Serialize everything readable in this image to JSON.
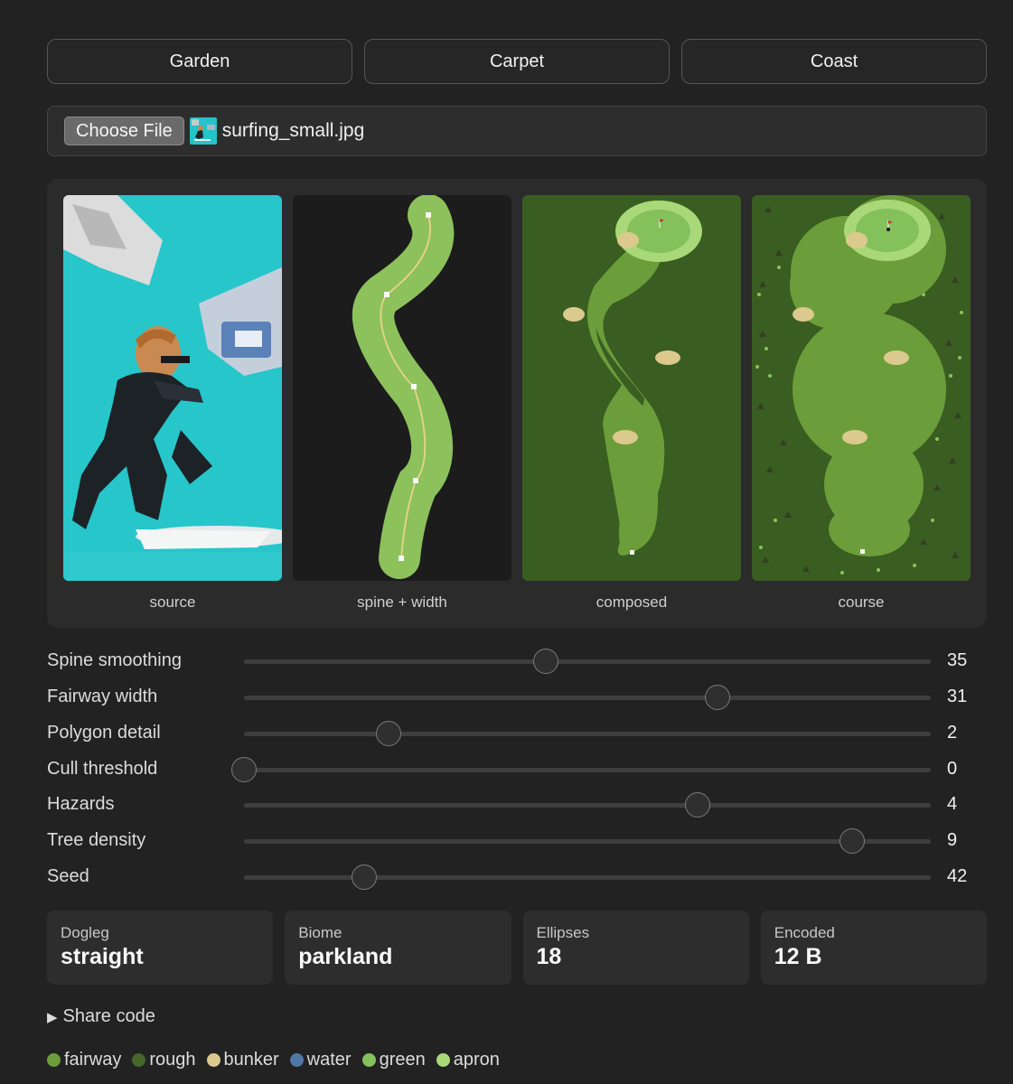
{
  "presets": [
    {
      "label": "Garden"
    },
    {
      "label": "Carpet"
    },
    {
      "label": "Coast"
    }
  ],
  "file": {
    "button_label": "Choose File",
    "filename": "surfing_small.jpg"
  },
  "views": [
    {
      "caption": "source"
    },
    {
      "caption": "spine + width"
    },
    {
      "caption": "composed"
    },
    {
      "caption": "course"
    }
  ],
  "sliders": [
    {
      "label": "Spine smoothing",
      "value": "35",
      "fraction": 0.44
    },
    {
      "label": "Fairway width",
      "value": "31",
      "fraction": 0.69
    },
    {
      "label": "Polygon detail",
      "value": "2",
      "fraction": 0.21
    },
    {
      "label": "Cull threshold",
      "value": "0",
      "fraction": 0.0
    },
    {
      "label": "Hazards",
      "value": "4",
      "fraction": 0.66
    },
    {
      "label": "Tree density",
      "value": "9",
      "fraction": 0.885
    },
    {
      "label": "Seed",
      "value": "42",
      "fraction": 0.175
    }
  ],
  "stats": [
    {
      "label": "Dogleg",
      "value": "straight"
    },
    {
      "label": "Biome",
      "value": "parkland"
    },
    {
      "label": "Ellipses",
      "value": "18"
    },
    {
      "label": "Encoded",
      "value": "12 B"
    }
  ],
  "share": {
    "label": "Share code",
    "arrow_icon": "triangle-right-icon"
  },
  "legend": [
    {
      "label": "fairway",
      "color": "#6b9e3a"
    },
    {
      "label": "rough",
      "color": "#46652a"
    },
    {
      "label": "bunker",
      "color": "#dcc98d"
    },
    {
      "label": "water",
      "color": "#4f77a8"
    },
    {
      "label": "green",
      "color": "#84c15a"
    },
    {
      "label": "apron",
      "color": "#a9d878"
    }
  ]
}
